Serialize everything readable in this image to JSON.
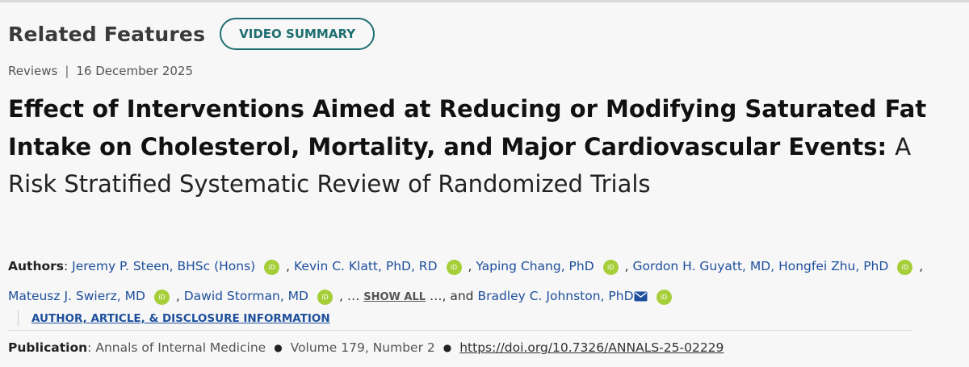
{
  "related_features": {
    "title": "Related Features",
    "video_button": "VIDEO SUMMARY"
  },
  "meta": {
    "type": "Reviews",
    "separator": "|",
    "date": "16 December 2025"
  },
  "article": {
    "title_bold": "Effect of Interventions Aimed at Reducing or Modifying Saturated Fat Intake on Cholesterol, Mortality, and Major Cardiovascular Events:",
    "subtitle": "A Risk Stratified Systematic Review of Randomized Trials"
  },
  "authors": {
    "label": "Authors",
    "colon": ":",
    "list": [
      "Jeremy P. Steen, BHSc (Hons)",
      "Kevin C. Klatt, PhD, RD",
      "Yaping Chang, PhD",
      "Gordon H. Guyatt, MD, Hongfei Zhu, PhD",
      "Mateusz J. Swierz, MD",
      "Dawid Storman, MD"
    ],
    "comma": ",",
    "ellipsis": "…",
    "show_all": "SHOW ALL",
    "and_text": ", and",
    "last_author": "Bradley C. Johnston, PhD",
    "orcid_text": "iD",
    "disclosure_link": "AUTHOR, ARTICLE, & DISCLOSURE INFORMATION"
  },
  "publication": {
    "label": "Publication",
    "colon": ":",
    "journal": "Annals of Internal Medicine",
    "bullet": "●",
    "volume": "Volume 179, Number 2",
    "doi": "https://doi.org/10.7326/ANNALS-25-02229"
  },
  "icons": {
    "orcid": "orcid-icon",
    "mail": "mail-icon",
    "orcid_color": "#a6ce39",
    "accent_teal": "#1f6f70",
    "link_blue": "#1e4f9c"
  }
}
